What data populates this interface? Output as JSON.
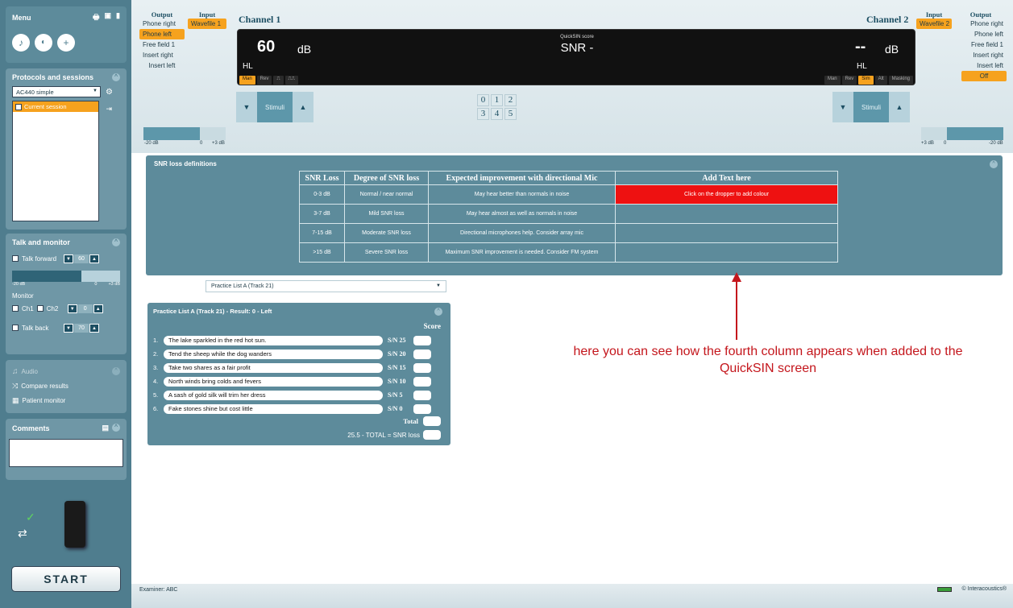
{
  "menu": {
    "label": "Menu"
  },
  "protocols": {
    "title": "Protocols and sessions",
    "selected_protocol": "AC440 simple",
    "current_session": "Current session"
  },
  "talk_monitor": {
    "title": "Talk and monitor",
    "talk_forward": "Talk forward",
    "talk_forward_value": "60",
    "slider_min": "-20 dB",
    "slider_mid": "0",
    "slider_max": "+3 dB",
    "monitor": "Monitor",
    "ch1": "Ch1",
    "ch2": "Ch2",
    "monitor_value": "0",
    "talk_back": "Talk back",
    "talk_back_value": "70"
  },
  "tools": {
    "audio": "Audio",
    "compare": "Compare results",
    "patient_monitor": "Patient monitor"
  },
  "comments": {
    "title": "Comments"
  },
  "start_button": "START",
  "channel1": {
    "title": "Channel 1",
    "output_header": "Output",
    "input_header": "Input",
    "outputs": [
      "Phone right",
      "Phone left",
      "Free field 1",
      "Insert right",
      "Insert left"
    ],
    "selected_output_index": 1,
    "input": "Wavefile 1",
    "level": "60",
    "unit": "dB",
    "hl": "HL",
    "modes": [
      "Man",
      "Rev",
      "⎍",
      "⎍⎍"
    ],
    "stimuli": "Stimuli",
    "slider_left": "-20 dB",
    "slider_mid": "0",
    "slider_right": "+3 dB"
  },
  "channel2": {
    "title": "Channel 2",
    "output_header": "Output",
    "input_header": "Input",
    "outputs": [
      "Phone right",
      "Phone left",
      "Free field 1",
      "Insert right",
      "Insert left",
      "Off"
    ],
    "selected_output_index": 5,
    "input": "Wavefile 2",
    "level": "--",
    "unit": "dB",
    "hl": "HL",
    "modes": [
      "Man",
      "Rev",
      "Sim",
      "Alt",
      "Masking"
    ],
    "stimuli": "Stimuli",
    "slider_left": "+3 dB",
    "slider_mid": "0",
    "slider_right": "-20 dB"
  },
  "display": {
    "caption": "QuickSIN score",
    "value": "SNR -"
  },
  "numpad": [
    "0",
    "1",
    "2",
    "3",
    "4",
    "5"
  ],
  "snr_loss": {
    "title": "SNR loss definitions",
    "columns": [
      "SNR Loss",
      "Degree of SNR loss",
      "Expected improvement with directional Mic",
      "Add Text here"
    ],
    "rows": [
      [
        "0-3 dB",
        "Normal / near normal",
        "May hear better than normals in noise",
        "Click on the dropper to add colour"
      ],
      [
        "3-7 dB",
        "Mild SNR loss",
        "May hear almost as well as normals in noise",
        ""
      ],
      [
        "7-15 dB",
        "Moderate SNR loss",
        "Directional microphones help. Consider array mic",
        ""
      ],
      [
        ">15 dB",
        "Severe SNR loss",
        "Maximum SNR improvement is needed. Consider FM system",
        ""
      ]
    ],
    "highlight_color": "#ee1111"
  },
  "practice": {
    "select_value": "Practice List A (Track 21)",
    "panel_title": "Practice List A (Track 21)  -  Result: 0  -  Left",
    "score_header": "Score",
    "sentences": [
      {
        "n": "1.",
        "text": "The lake sparkled in the red hot sun.",
        "sn": "S/N 25"
      },
      {
        "n": "2.",
        "text": "Tend the sheep while the dog wanders",
        "sn": "S/N 20"
      },
      {
        "n": "3.",
        "text": "Take two shares as a fair profit",
        "sn": "S/N 15"
      },
      {
        "n": "4.",
        "text": "North winds bring colds and fevers",
        "sn": "S/N 10"
      },
      {
        "n": "5.",
        "text": "A sash of gold silk will trim her dress",
        "sn": "S/N 5"
      },
      {
        "n": "6.",
        "text": "Fake stones shine but cost little",
        "sn": "S/N 0"
      }
    ],
    "total_label": "Total",
    "snr_loss_label": "25.5 - TOTAL = SNR loss"
  },
  "annotation": "here you can see how the fourth column appears when added to the QuickSIN screen",
  "footer": {
    "examiner": "Examiner: ABC",
    "brand": "© Interacoustics®"
  }
}
